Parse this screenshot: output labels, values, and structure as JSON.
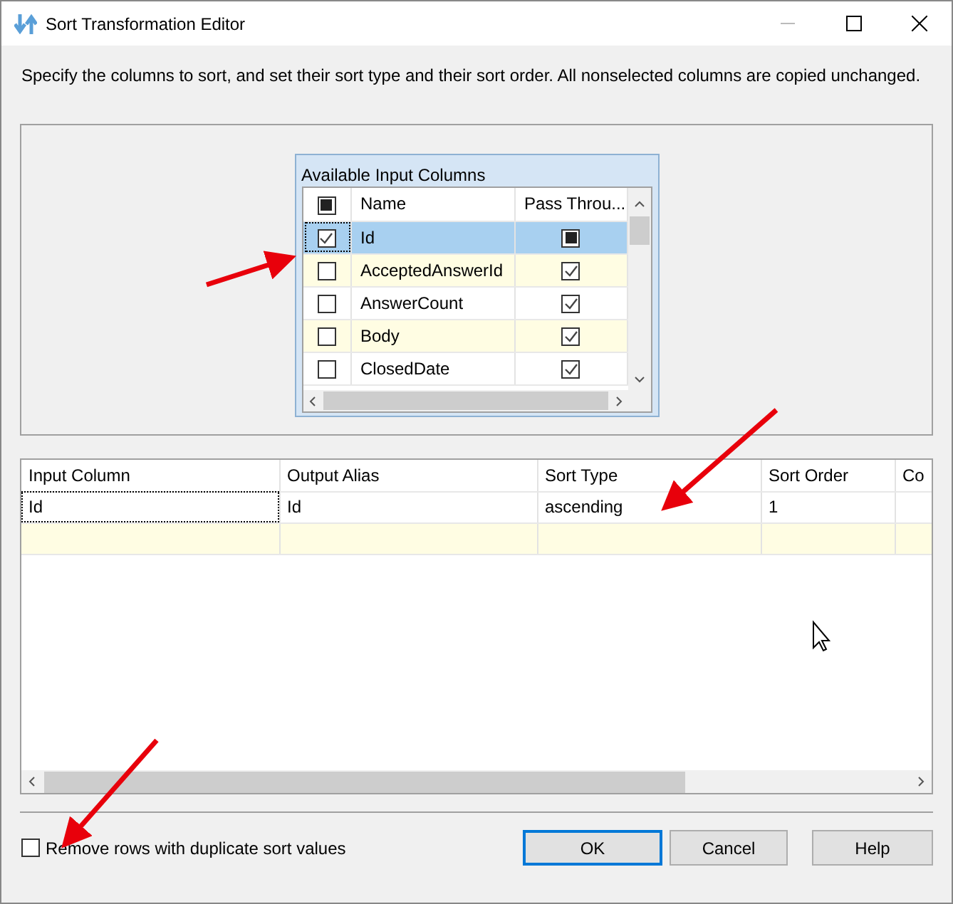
{
  "window": {
    "title": "Sort Transformation Editor",
    "minimize_disabled": true
  },
  "description": "Specify the columns to sort, and set their sort type and their sort order. All nonselected columns are copied unchanged.",
  "available_columns": {
    "title": "Available Input Columns",
    "header": {
      "select_all_mixed": true,
      "name": "Name",
      "pass_through": "Pass Throu..."
    },
    "rows": [
      {
        "name": "Id",
        "checked": true,
        "selected": true,
        "pass_through_checked": true,
        "pass_through_mixed": true
      },
      {
        "name": "AcceptedAnswerId",
        "checked": false,
        "selected": false,
        "pass_through_checked": true,
        "pass_through_mixed": false
      },
      {
        "name": "AnswerCount",
        "checked": false,
        "selected": false,
        "pass_through_checked": true,
        "pass_through_mixed": false
      },
      {
        "name": "Body",
        "checked": false,
        "selected": false,
        "pass_through_checked": true,
        "pass_through_mixed": false
      },
      {
        "name": "ClosedDate",
        "checked": false,
        "selected": false,
        "pass_through_checked": true,
        "pass_through_mixed": false
      }
    ]
  },
  "sort_grid": {
    "columns": [
      "Input Column",
      "Output Alias",
      "Sort Type",
      "Sort Order",
      "Co"
    ],
    "rows": [
      [
        "Id",
        "Id",
        "ascending",
        "1",
        ""
      ],
      [
        "",
        "",
        "",
        "",
        ""
      ]
    ]
  },
  "remove_duplicates": {
    "label": "Remove rows with duplicate sort values",
    "checked": false
  },
  "buttons": [
    {
      "label": "OK",
      "default": true
    },
    {
      "label": "Cancel",
      "default": false
    },
    {
      "label": "Help",
      "default": false
    }
  ]
}
